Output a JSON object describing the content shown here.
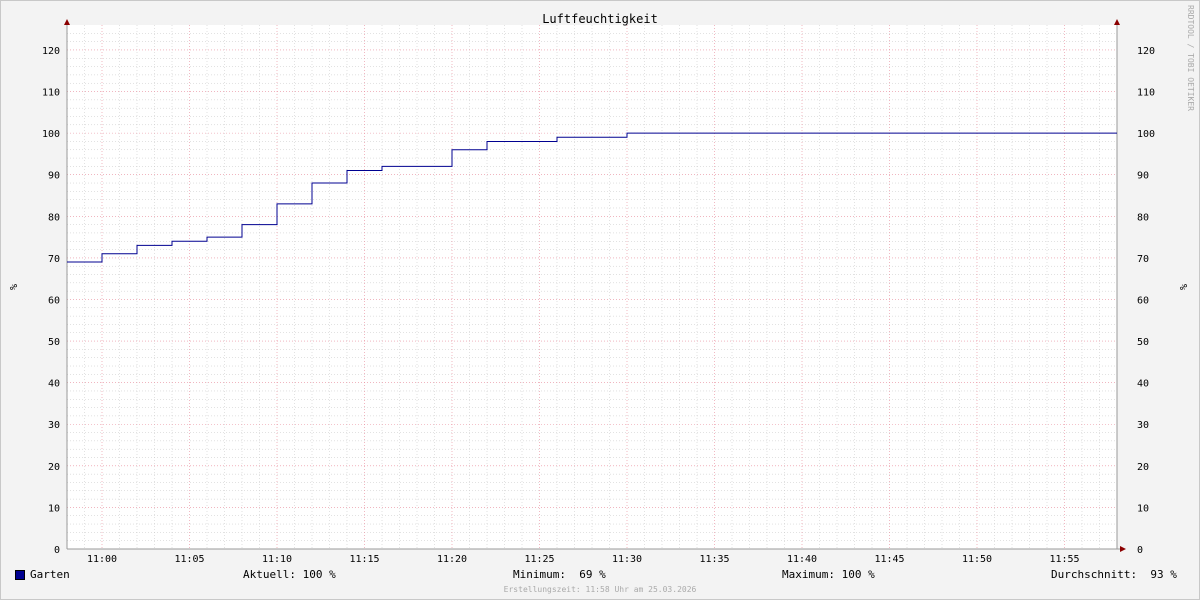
{
  "chart_data": {
    "type": "line",
    "title": "Luftfeuchtigkeit",
    "ylabel_left": "%",
    "ylabel_right": "%",
    "ylim": [
      0,
      126
    ],
    "yticks": [
      0,
      10,
      20,
      30,
      40,
      50,
      60,
      70,
      80,
      90,
      100,
      110,
      120
    ],
    "xlim": [
      "10:58",
      "11:58"
    ],
    "xticks": [
      "11:00",
      "11:05",
      "11:10",
      "11:15",
      "11:20",
      "11:25",
      "11:30",
      "11:35",
      "11:40",
      "11:45",
      "11:50",
      "11:55"
    ],
    "grid": true,
    "series": [
      {
        "name": "Garten",
        "color": "#000090",
        "x": [
          "10:58",
          "11:00",
          "11:02",
          "11:04",
          "11:06",
          "11:08",
          "11:10",
          "11:12",
          "11:14",
          "11:16",
          "11:20",
          "11:22",
          "11:26",
          "11:30",
          "11:58"
        ],
        "values": [
          69,
          71,
          73,
          74,
          75,
          78,
          83,
          88,
          91,
          92,
          96,
          98,
          99,
          100,
          100
        ]
      }
    ]
  },
  "legend": {
    "name": "Garten",
    "swatch_color": "#000090",
    "aktuell": "Aktuell: 100 %",
    "minimum": "Minimum:  69 %",
    "maximum": "Maximum: 100 %",
    "durchschnitt": "Durchschnitt:  93 %"
  },
  "side_text": "RRDTOOL / TOBI OETIKER",
  "footer": "Erstellungszeit: 11:58 Uhr am 25.03.2026",
  "colors": {
    "background": "#f3f3f3",
    "plot_bg": "#ffffff",
    "major_grid": "#e88a9a",
    "minor_grid": "#c4c4c4",
    "axis_arrow": "#8b0000"
  }
}
